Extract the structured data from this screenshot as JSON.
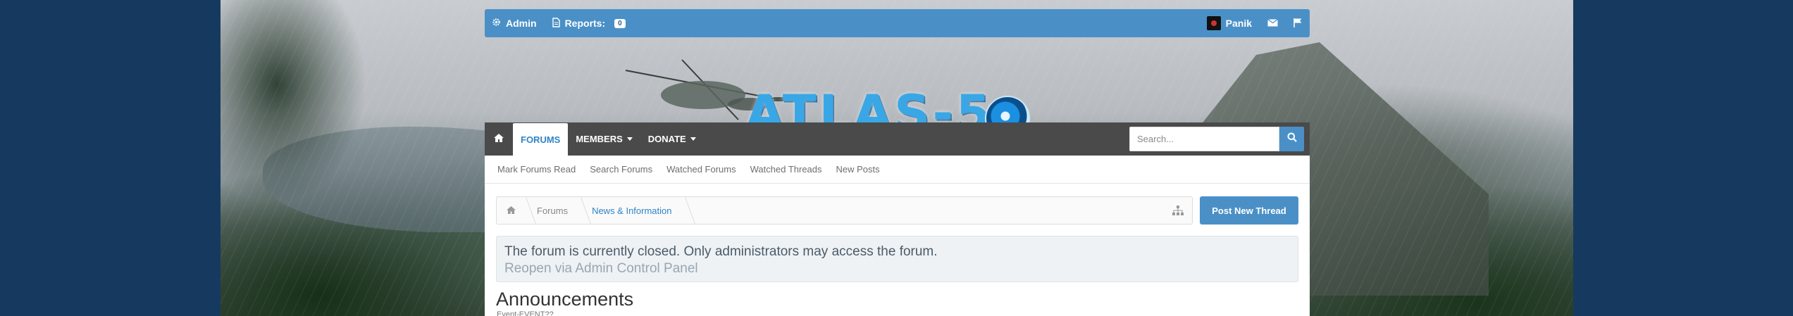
{
  "admin_bar": {
    "admin_label": "Admin",
    "reports_label": "Reports:",
    "reports_count": "0",
    "username": "Panik"
  },
  "logo": {
    "text": "ATLAS-5"
  },
  "navbar": {
    "tabs": [
      {
        "label": "FORUMS",
        "active": true
      },
      {
        "label": "MEMBERS",
        "dropdown": true
      },
      {
        "label": "DONATE",
        "dropdown": true
      }
    ],
    "search_placeholder": "Search..."
  },
  "subnav": {
    "links": [
      "Mark Forums Read",
      "Search Forums",
      "Watched Forums",
      "Watched Threads",
      "New Posts"
    ]
  },
  "breadcrumb": {
    "items": [
      "Forums",
      "News & Information"
    ]
  },
  "post_button": "Post New Thread",
  "notice": {
    "message": "The forum is currently closed. Only administrators may access the forum.",
    "link": "Reopen via Admin Control Panel"
  },
  "section": {
    "title": "Announcements",
    "subtitle": "Event-EVENT??"
  },
  "colors": {
    "accent": "#4a90c7",
    "navbar": "#4a4a4a",
    "page_bg": "#163a5f"
  },
  "icons": [
    "gear-icon",
    "document-icon",
    "envelope-icon",
    "flag-icon",
    "home-icon",
    "search-icon",
    "sitemap-icon"
  ]
}
